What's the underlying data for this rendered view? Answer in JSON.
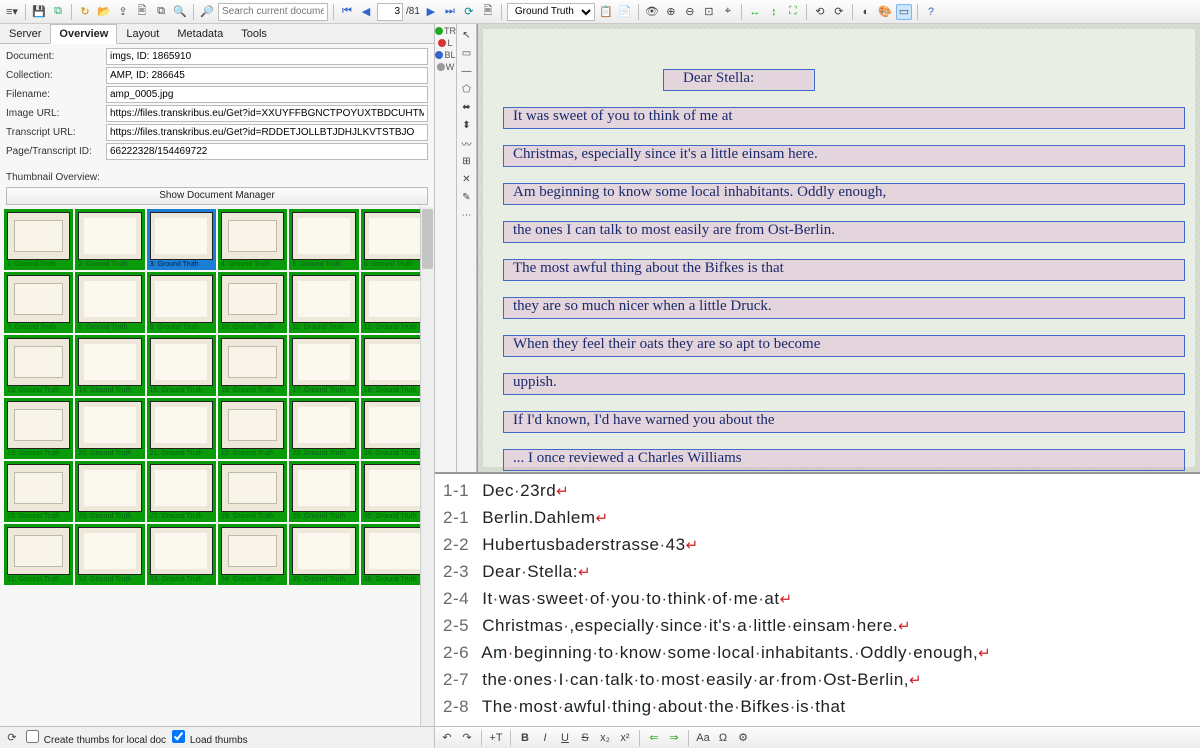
{
  "toolbar": {
    "search_placeholder": "Search current document...",
    "page_current": "3",
    "page_total": "/81",
    "status_combo": "Ground Truth"
  },
  "tabs": [
    "Server",
    "Overview",
    "Layout",
    "Metadata",
    "Tools"
  ],
  "active_tab": 1,
  "form": {
    "document_label": "Document:",
    "document_value": "imgs, ID: 1865910",
    "collection_label": "Collection:",
    "collection_value": "AMP, ID: 286645",
    "filename_label": "Filename:",
    "filename_value": "amp_0005.jpg",
    "imageurl_label": "Image URL:",
    "imageurl_value": "https://files.transkribus.eu/Get?id=XXUYFFBGNCTPOYUXTBDCUHTM&fileType=view",
    "transcripturl_label": "Transcript URL:",
    "transcripturl_value": "https://files.transkribus.eu/Get?id=RDDETJOLLBTJDHJLKVTSTBJO",
    "pageid_label": "Page/Transcript ID:",
    "pageid_value": "66222328/154469722"
  },
  "thumbnail_section_label": "Thumbnail Overview:",
  "doc_manager_btn": "Show Document Manager",
  "thumb_count": 36,
  "thumb_selected": 2,
  "thumb_label_prefix": "Ground Truth",
  "left_footer": {
    "create_thumbs": "Create thumbs for local doc",
    "load_thumbs": "Load thumbs"
  },
  "side_labels": [
    "TR",
    "L",
    "BL",
    "W"
  ],
  "transcript_lines": [
    {
      "n": "1-1",
      "words": [
        "Dec",
        "23rd"
      ],
      "ret": true
    },
    {
      "n": "2-1",
      "words": [
        "Berlin.Dahlem"
      ],
      "ret": true
    },
    {
      "n": "2-2",
      "words": [
        "Hubertusbaderstrasse",
        "43"
      ],
      "ret": true
    },
    {
      "n": "2-3",
      "words": [
        "Dear",
        "Stella:"
      ],
      "ret": true
    },
    {
      "n": "2-4",
      "words": [
        "It",
        "was",
        "sweet",
        "of",
        "you",
        "to",
        "think",
        "of",
        "me",
        "at"
      ],
      "ret": true
    },
    {
      "n": "2-5",
      "words": [
        "Christmas",
        ",especially",
        "since",
        "it's",
        "a",
        "little",
        "einsam",
        "here."
      ],
      "ret": true
    },
    {
      "n": "2-6",
      "words": [
        "Am",
        "beginning",
        "to",
        "know",
        "some",
        "local",
        "inhabitants.",
        "Oddly",
        "enough,"
      ],
      "ret": true
    },
    {
      "n": "2-7",
      "words": [
        "the",
        "ones",
        "I",
        "can",
        "talk",
        "to",
        "most",
        "easily",
        "ar",
        "from",
        "Ost-Berlin,"
      ],
      "ret": true
    },
    {
      "n": "2-8",
      "words": [
        "The",
        "most",
        "awful",
        "thing",
        "about",
        "the",
        "Bifkes",
        "is",
        "that"
      ],
      "ret": false
    }
  ],
  "handwriting_lines": [
    "Dear Stella:",
    "It was sweet of you to think of me at",
    "Christmas, especially since it's a little einsam here.",
    "Am beginning to know some local inhabitants. Oddly enough,",
    "the ones I can talk to most easily are from Ost-Berlin.",
    "The most awful thing about the Bifkes is that",
    "they are so much nicer when a little Druck.",
    "When they feel their oats they are so apt to become",
    "uppish.",
    "If I'd known, I'd have warned you about the",
    "... I once reviewed a Charles Williams"
  ]
}
